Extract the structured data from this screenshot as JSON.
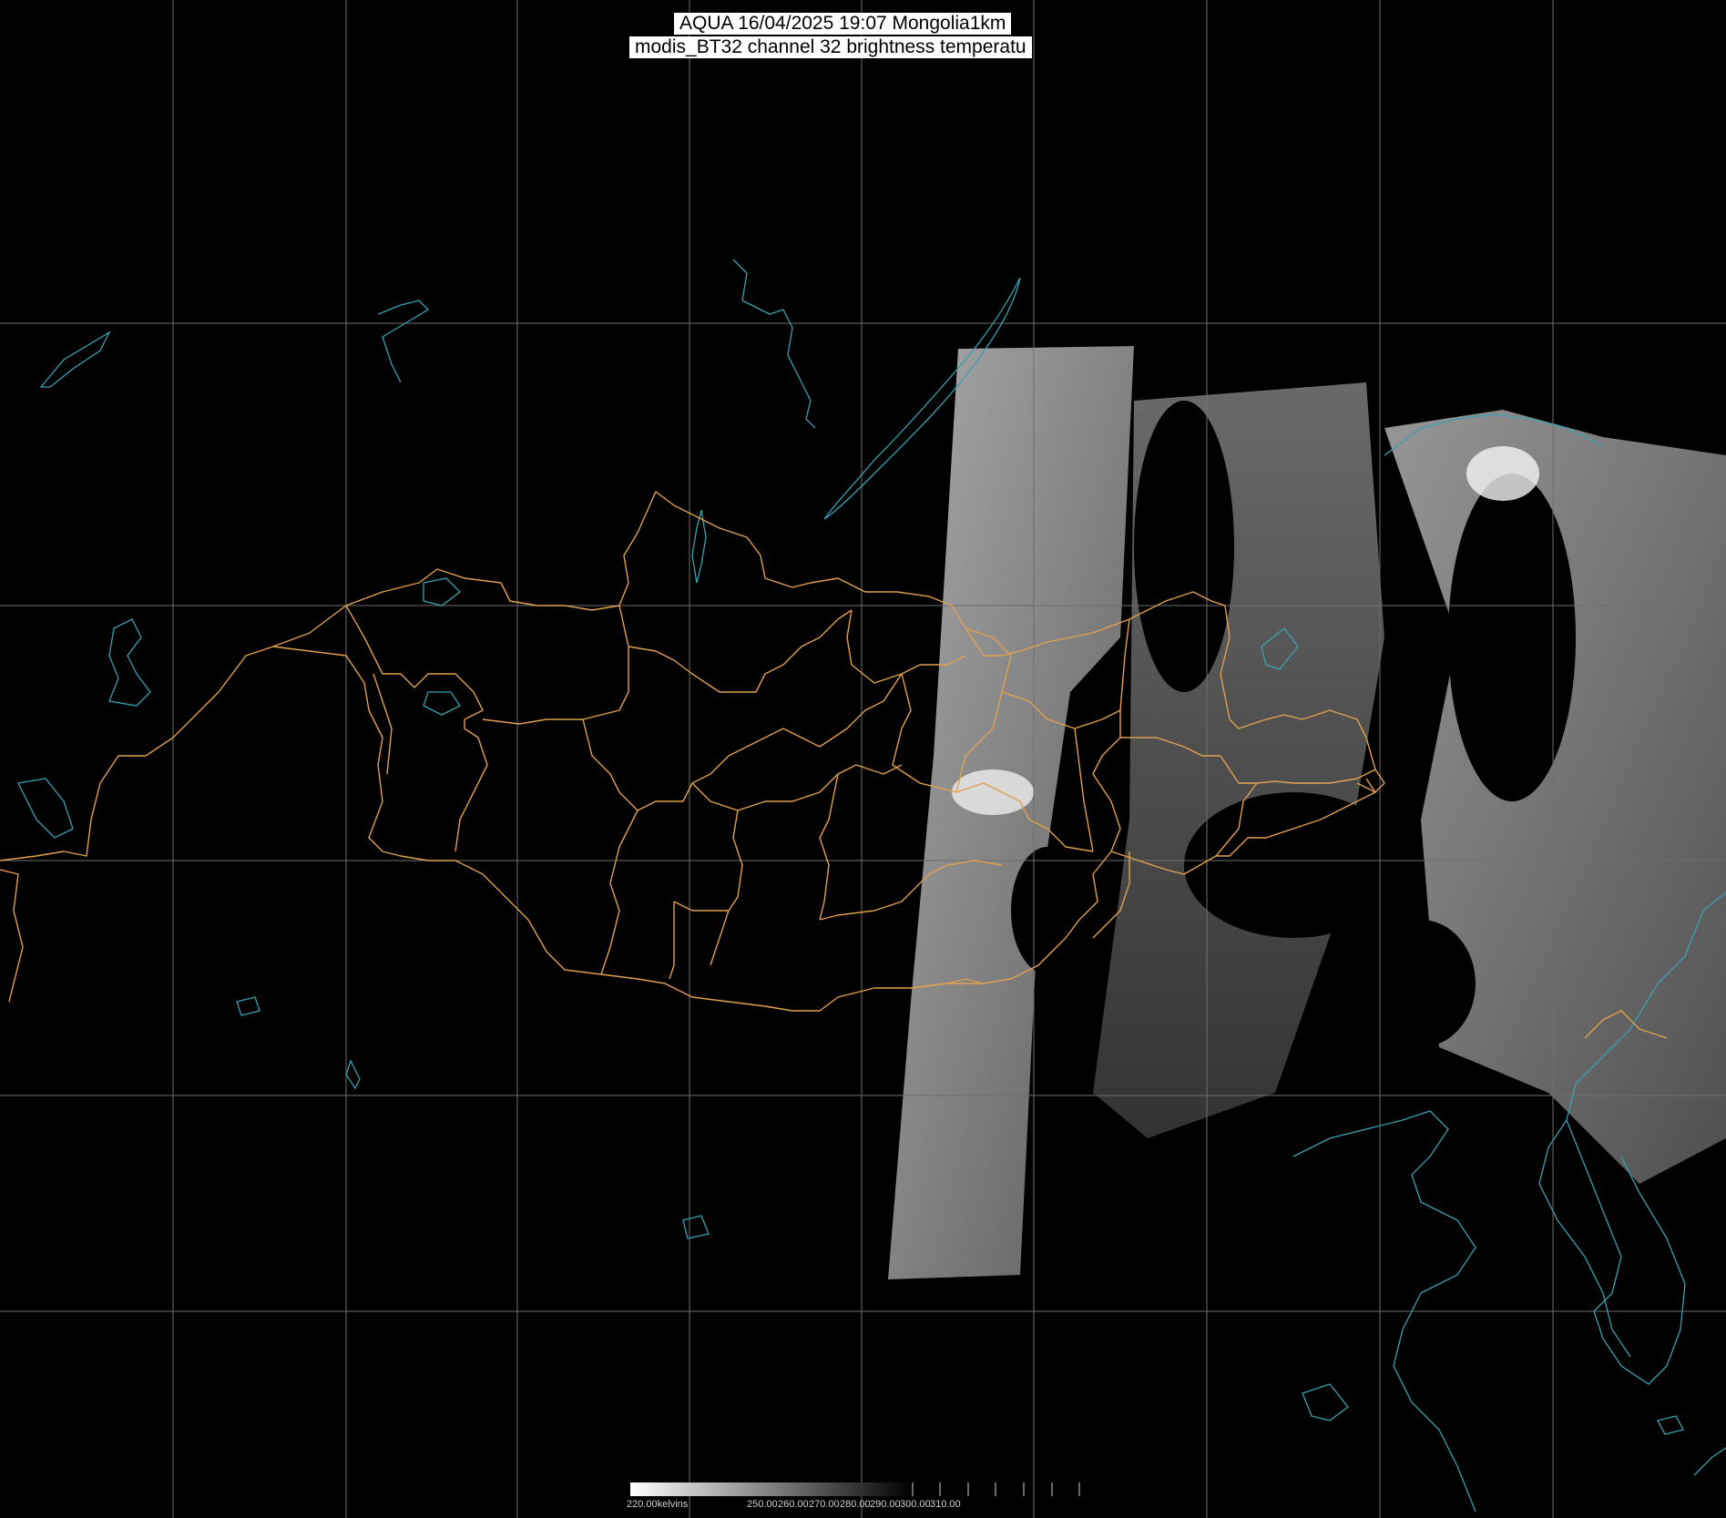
{
  "header": {
    "line1": "AQUA 16/04/2025 19:07 Mongolia1km",
    "line2": "modis_BT32 channel 32 brightness temperatu"
  },
  "colorbar": {
    "min_label": "220.00kelvins",
    "ticks": [
      "250.00",
      "260.00",
      "270.00",
      "280.00",
      "290.00",
      "300.00",
      "310.00"
    ],
    "gradient": [
      "#ffffff",
      "#000000"
    ]
  },
  "colors": {
    "background": "#000000",
    "grid": "#6e6e6e",
    "borders": "#e0a050",
    "coast": "#3aa0b0",
    "label_bg": "#ffffff"
  }
}
